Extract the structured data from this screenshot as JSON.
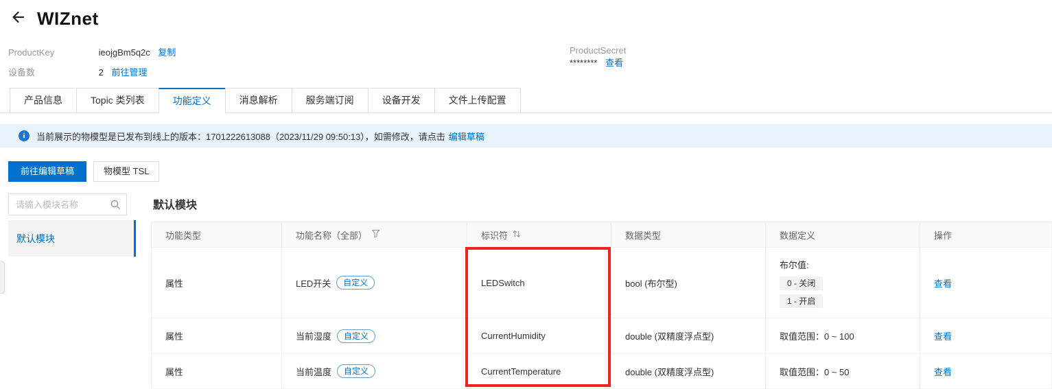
{
  "header": {
    "title": "WIZnet",
    "product_key": {
      "label": "ProductKey",
      "value": "ieojgBm5q2c",
      "copy_link": "复制"
    },
    "product_secret": {
      "label": "ProductSecret",
      "value": "********",
      "view_link": "查看"
    },
    "device_count": {
      "label": "设备数",
      "value": "2",
      "manage_link": "前往管理"
    }
  },
  "tabs": [
    {
      "label": "产品信息",
      "active": false
    },
    {
      "label": "Topic 类列表",
      "active": false
    },
    {
      "label": "功能定义",
      "active": true
    },
    {
      "label": "消息解析",
      "active": false
    },
    {
      "label": "服务端订阅",
      "active": false
    },
    {
      "label": "设备开发",
      "active": false
    },
    {
      "label": "文件上传配置",
      "active": false
    }
  ],
  "banner": {
    "text": "当前展示的物模型是已发布到线上的版本：1701222613088（2023/11/29 09:50:13），如需修改，请点击",
    "link_label": "编辑草稿"
  },
  "toolbar": {
    "edit_draft_button": "前往编辑草稿",
    "tsl_button": "物模型 TSL"
  },
  "sidebar": {
    "search_placeholder": "请输入模块名称",
    "items": [
      {
        "label": "默认模块",
        "selected": true
      }
    ]
  },
  "main": {
    "module_title": "默认模块",
    "table": {
      "columns": [
        "功能类型",
        "功能名称（全部）",
        "标识符",
        "数据类型",
        "数据定义",
        "操作"
      ],
      "rows": [
        {
          "type": "属性",
          "name": "LED开关",
          "tag": "自定义",
          "identifier": "LEDSwitch",
          "data_type": "bool (布尔型)",
          "definition": {
            "label": "布尔值:",
            "options": [
              "0 - 关闭",
              "1 - 开启"
            ]
          },
          "action": "查看"
        },
        {
          "type": "属性",
          "name": "当前湿度",
          "tag": "自定义",
          "identifier": "CurrentHumidity",
          "data_type": "double (双精度浮点型)",
          "definition": {
            "text": "取值范围：0 ~ 100"
          },
          "action": "查看"
        },
        {
          "type": "属性",
          "name": "当前温度",
          "tag": "自定义",
          "identifier": "CurrentTemperature",
          "data_type": "double (双精度浮点型)",
          "definition": {
            "text": "取值范围：0 ~ 50"
          },
          "action": "查看"
        }
      ]
    }
  },
  "annotation": {
    "shape": "red-rectangle-highlight",
    "around": "标识符列"
  },
  "colors": {
    "accent_blue": "#0070cc",
    "annotation_red": "#ee2424",
    "banner_bg": "#e8f2fc"
  }
}
